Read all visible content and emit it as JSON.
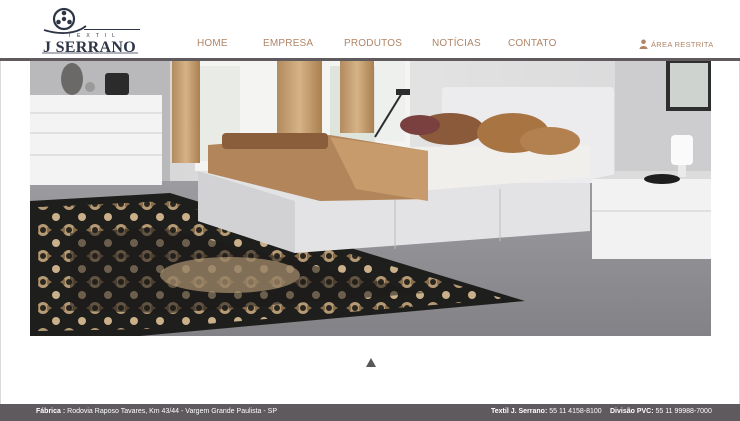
{
  "brand": {
    "top_text": "TEXTIL",
    "name": "J SERRANO"
  },
  "nav": {
    "items": [
      {
        "label": "HOME"
      },
      {
        "label": "EMPRESA"
      },
      {
        "label": "PRODUTOS"
      },
      {
        "label": "NOTÍCIAS"
      },
      {
        "label": "CONTATO"
      }
    ],
    "restricted_label": "ÁREA RESTRITA"
  },
  "icons": {
    "restricted": "user-icon",
    "slider": "triangle-up-icon"
  },
  "colors": {
    "nav_text": "#b08567",
    "brand_text": "#2e3547",
    "bar": "#5e5a5e"
  },
  "footer": {
    "factory_label": "Fábrica :",
    "factory_address": "Rodovia Raposo Tavares, Km 43/44 - Vargem Grande Paulista - SP",
    "textil_label": "Textil J. Serrano:",
    "textil_phone": "55 11 4158-8100",
    "pvc_label": "Divisão PVC:",
    "pvc_phone": "55 11  99988-7000"
  }
}
